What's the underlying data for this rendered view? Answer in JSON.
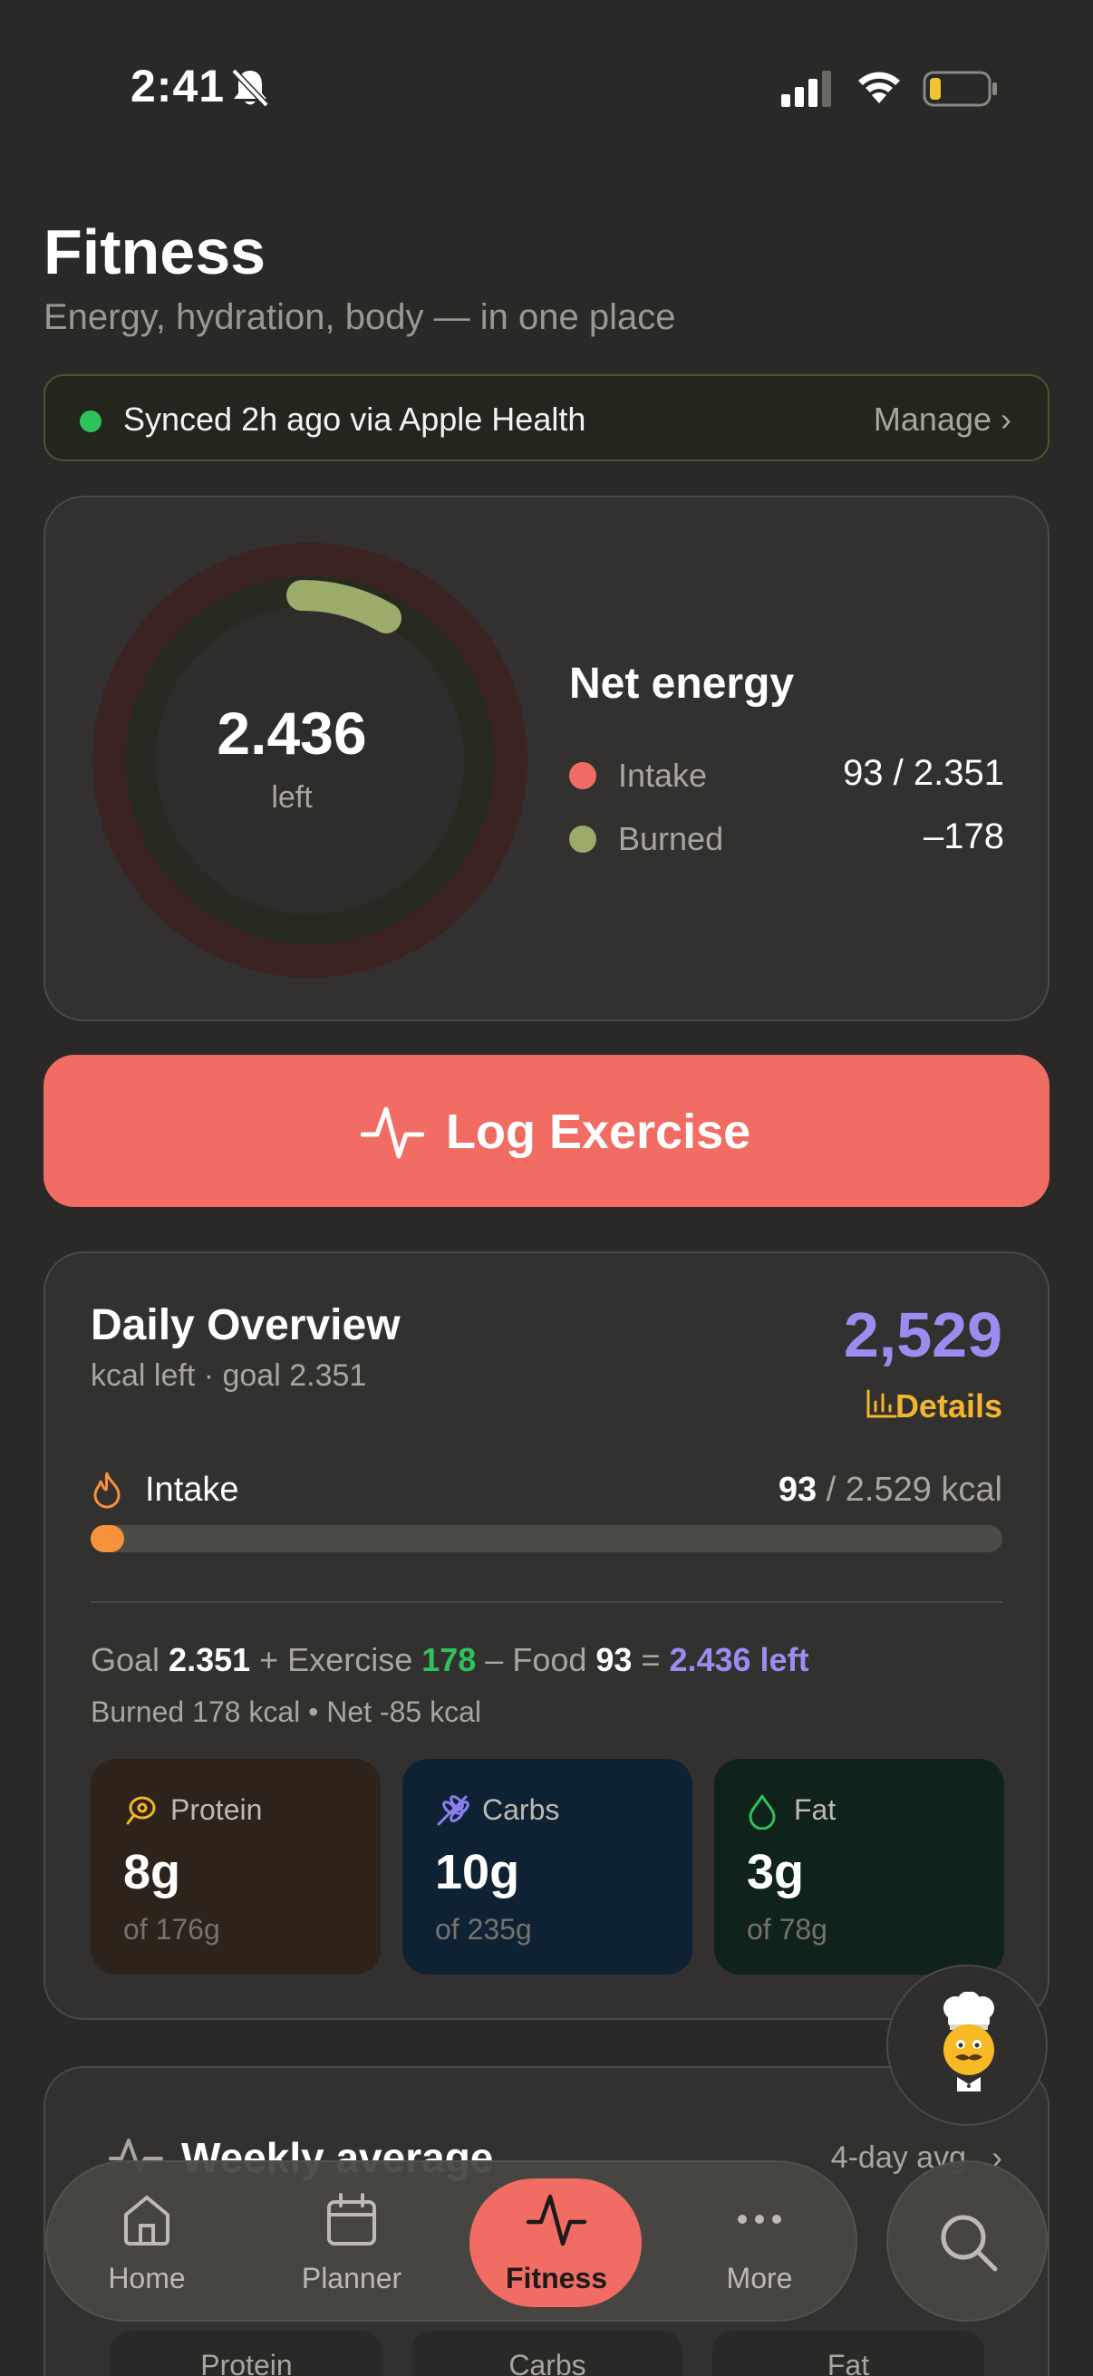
{
  "status_bar": {
    "time": "2:41"
  },
  "header": {
    "title": "Fitness",
    "subtitle": "Energy, hydration, body — in one place"
  },
  "sync": {
    "text": "Synced 2h ago via Apple Health",
    "manage": "Manage ›",
    "dot_color": "#2fc15a"
  },
  "energy": {
    "ring_value": "2.436",
    "ring_label": "left",
    "title": "Net energy",
    "legend": [
      {
        "label": "Intake",
        "value": "93 / 2.351",
        "color": "#f16c63"
      },
      {
        "label": "Burned",
        "value": "–178",
        "color": "#9aab6a"
      }
    ]
  },
  "log_exercise": {
    "label": "Log Exercise"
  },
  "daily": {
    "title": "Daily Overview",
    "subtitle": "kcal left · goal 2.351",
    "big_value": "2,529",
    "details": "Details",
    "intake_label": "Intake",
    "intake_current": "93",
    "intake_total": " / 2.529 kcal",
    "intake_progress": 0.037,
    "equation": {
      "goal_label": "Goal ",
      "goal": "2.351",
      "exercise_label": " + Exercise ",
      "exercise": "178",
      "food_label": " – Food ",
      "food": "93",
      "eq": " = ",
      "result": "2.436 left"
    },
    "burned_line": "Burned 178 kcal • Net -85 kcal",
    "macros": [
      {
        "name": "Protein",
        "value": "8g",
        "of": "of 176g"
      },
      {
        "name": "Carbs",
        "value": "10g",
        "of": "of 235g"
      },
      {
        "name": "Fat",
        "value": "3g",
        "of": "of 78g"
      }
    ]
  },
  "weekly": {
    "title": "Weekly average",
    "avg": "4-day avg",
    "columns": [
      "Protein",
      "Carbs",
      "Fat"
    ]
  },
  "tabs": [
    {
      "label": "Home",
      "icon": "home-icon"
    },
    {
      "label": "Planner",
      "icon": "calendar-icon"
    },
    {
      "label": "Fitness",
      "icon": "activity-icon"
    },
    {
      "label": "More",
      "icon": "more-icon"
    }
  ],
  "colors": {
    "accent": "#f16c63",
    "purple": "#9b8df0",
    "gold": "#f1b62e",
    "green": "#2fc15a"
  }
}
